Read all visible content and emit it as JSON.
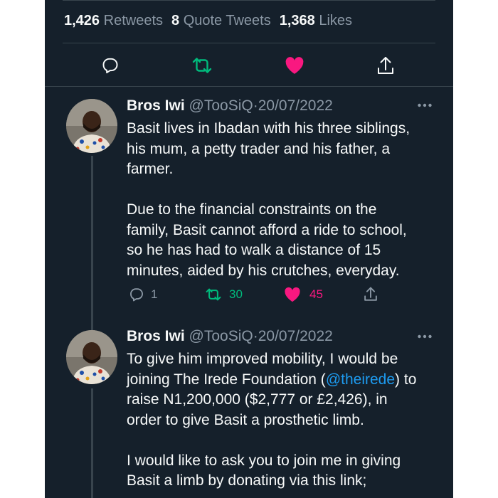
{
  "colors": {
    "background": "#15202b",
    "text": "#f7f9f9",
    "muted": "#8b98a5",
    "retweet": "#00ba7c",
    "like": "#f91880",
    "link": "#1d9bf0",
    "divider": "#38444d"
  },
  "stats": {
    "retweets_count": "1,426",
    "retweets_label": "Retweets",
    "quotes_count": "8",
    "quotes_label": "Quote Tweets",
    "likes_count": "1,368",
    "likes_label": "Likes"
  },
  "actions": {
    "icons": [
      "reply-icon",
      "retweet-icon",
      "like-icon",
      "share-icon"
    ],
    "liked": true
  },
  "tweets": [
    {
      "author": "Bros Iwi",
      "handle": "@TooSiQ",
      "separator": "·",
      "date": "20/07/2022",
      "lines": [
        "Basit lives in Ibadan with his three siblings,",
        "his mum, a petty trader and his father, a",
        "farmer.",
        "",
        "Due to the financial constraints on the",
        "family, Basit cannot afford a ride to school,",
        "so he has had to walk a distance of 15",
        "minutes, aided by his crutches, everyday."
      ],
      "reply_count": "1",
      "retweet_count": "30",
      "like_count": "45"
    },
    {
      "author": "Bros Iwi",
      "handle": "@TooSiQ",
      "separator": "·",
      "date": "20/07/2022",
      "line1": "To give him improved mobility, I would be",
      "line2_before": "joining The Irede Foundation (",
      "line2_mention": "@theirede",
      "line2_after": ") to",
      "line3": "raise N1,200,000 ($2,777 or £2,426), in",
      "line4": "order to give Basit a prosthetic limb.",
      "line6": "I would like to ask you to join me in giving",
      "line7": "Basit a limb by donating via this link;"
    }
  ]
}
